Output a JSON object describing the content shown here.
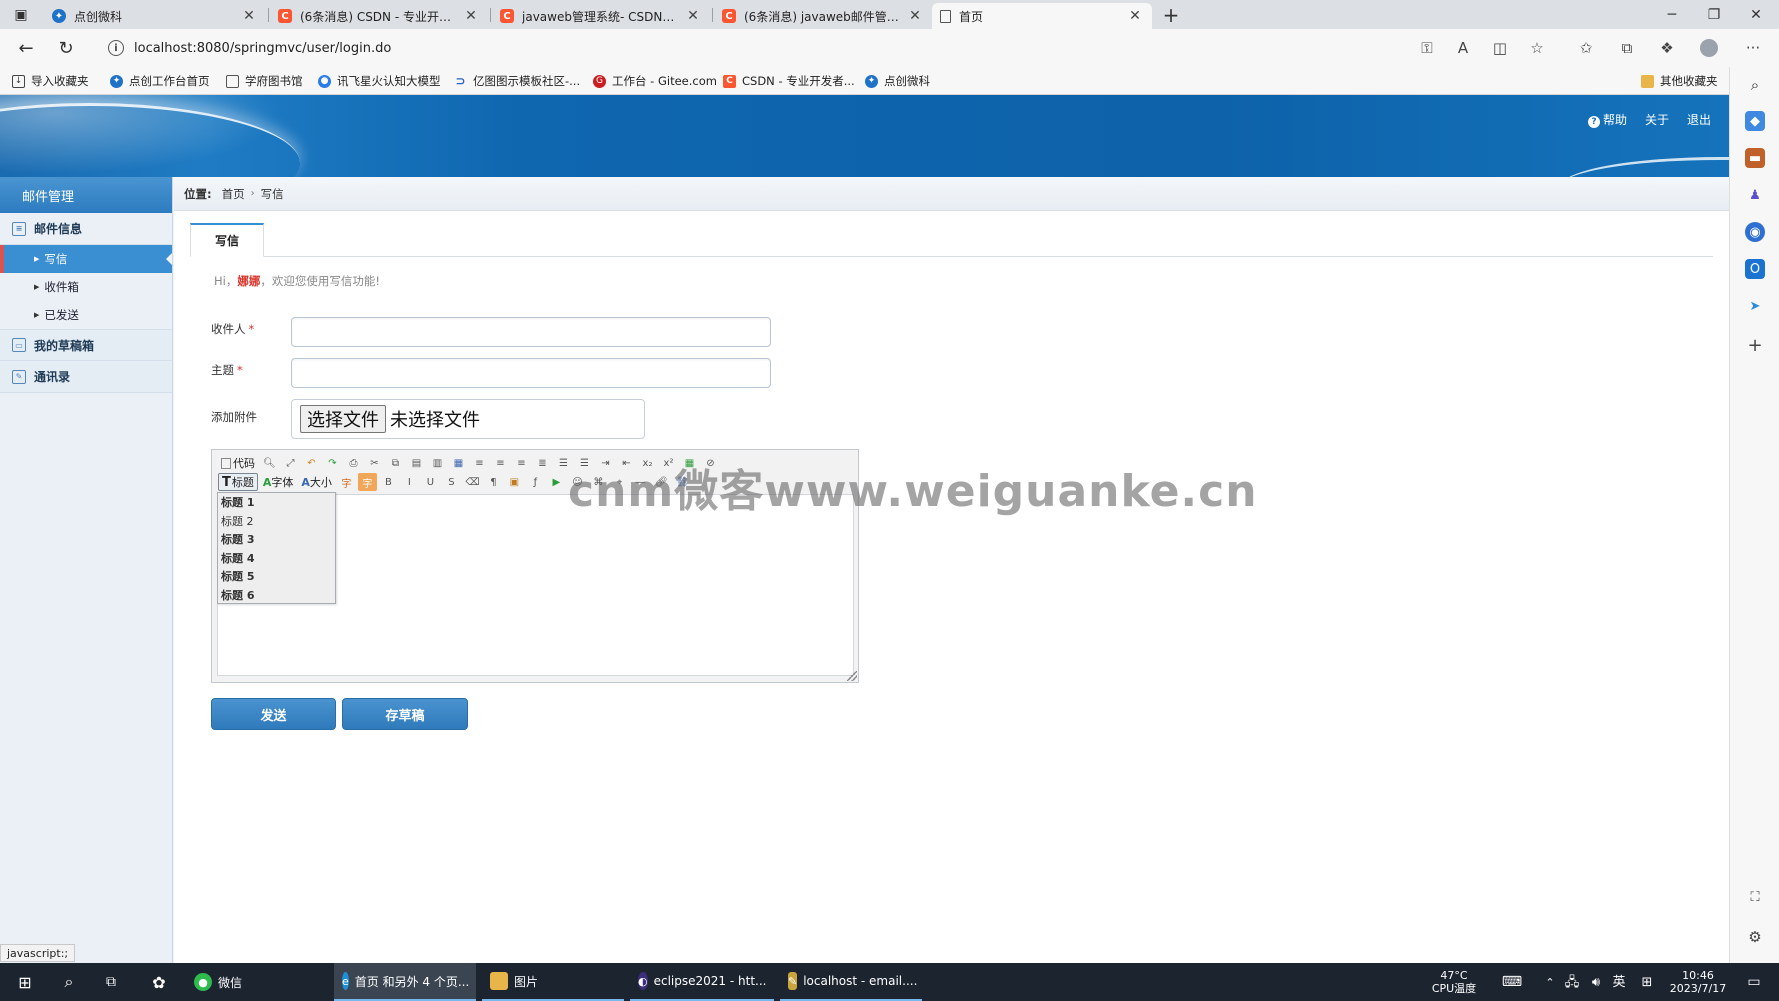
{
  "browser": {
    "tabs": [
      {
        "label": "点创微科",
        "icon": "bluebird-icon",
        "active": false
      },
      {
        "label": "(6条消息) CSDN - 专业开发者社区",
        "icon": "csdn-icon",
        "active": false
      },
      {
        "label": "javaweb管理系统- CSDN搜索",
        "icon": "csdn-icon",
        "active": false
      },
      {
        "label": "(6条消息) javaweb邮件管理系统_",
        "icon": "csdn-icon",
        "active": false
      },
      {
        "label": "首页",
        "icon": "page-icon",
        "active": true
      }
    ],
    "url": "localhost:8080/springmvc/user/login.do",
    "bookmarks": [
      {
        "label": "导入收藏夹",
        "icon": "import-icon"
      },
      {
        "label": "点创工作台首页",
        "icon": "bluebird-icon"
      },
      {
        "label": "学府图书馆",
        "icon": "page-icon"
      },
      {
        "label": "讯飞星火认知大模型",
        "icon": "spark-icon"
      },
      {
        "label": "亿图图示模板社区-...",
        "icon": "edraw-icon"
      },
      {
        "label": "工作台 - Gitee.com",
        "icon": "gitee-icon"
      },
      {
        "label": "CSDN - 专业开发者...",
        "icon": "csdn-icon"
      },
      {
        "label": "点创微科",
        "icon": "bluebird-icon"
      }
    ],
    "other_bookmarks": "其他收藏夹"
  },
  "app": {
    "top_links": {
      "help": "帮助",
      "about": "关于",
      "logout": "退出"
    },
    "nav_title": "邮件管理",
    "nav": {
      "mail_info": "邮件信息",
      "write": "写信",
      "inbox": "收件箱",
      "sent": "已发送",
      "drafts": "我的草稿箱",
      "contacts": "通讯录"
    },
    "location": {
      "label": "位置:",
      "home": "首页",
      "current": "写信"
    },
    "tab_label": "写信",
    "welcome": {
      "prefix": "Hi，",
      "username": "娜娜",
      "suffix": "，欢迎您使用写信功能!"
    },
    "form": {
      "recipient_label": "收件人",
      "subject_label": "主题",
      "attachment_label": "添加附件",
      "file_button": "选择文件",
      "file_status": "未选择文件",
      "required_mark": "*"
    },
    "editor": {
      "code_label": "代码",
      "heading_label": "标题",
      "font_label": "字体",
      "size_label": "大小",
      "heading_options": [
        "标题 1",
        "标题 2",
        "标题 3",
        "标题 4",
        "标题 5",
        "标题 6"
      ]
    },
    "buttons": {
      "send": "发送",
      "save_draft": "存草稿"
    }
  },
  "watermark": "cnm微客www.weiguanke.cn",
  "status_hint": "javascript:;",
  "taskbar": {
    "wechat": "微信",
    "edge": "首页 和另外 4 个页...",
    "pictures": "图片",
    "eclipse": "eclipse2021 - htt...",
    "localhost": "localhost - email....",
    "temp": "47°C",
    "cpu": "CPU温度",
    "ime": "英",
    "time": "10:46",
    "date": "2023/7/17"
  }
}
